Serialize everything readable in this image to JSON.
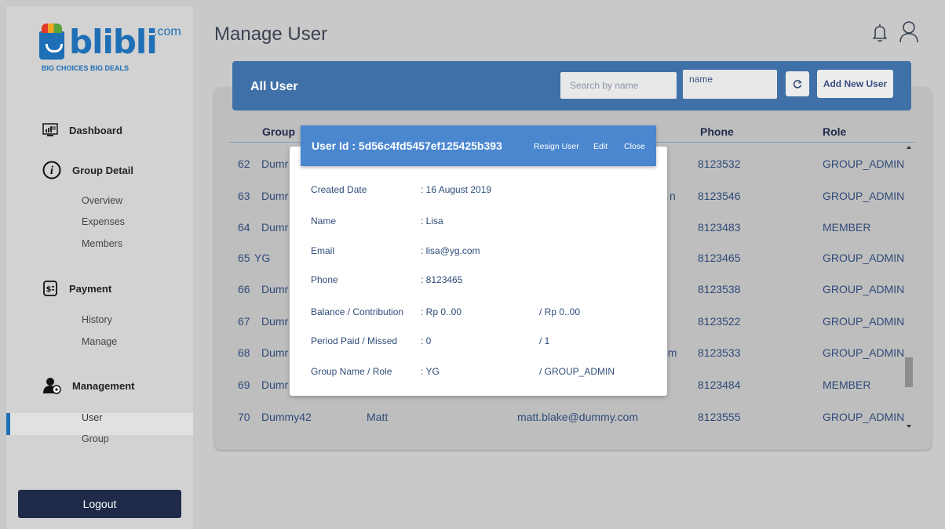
{
  "app": {
    "logo_text": "blibli",
    "logo_suffix": ".com",
    "logo_tagline": "BIG CHOICES BIG DEALS",
    "brand_color": "#1e6fb5"
  },
  "sidebar": {
    "dashboard": "Dashboard",
    "group_detail": "Group Detail",
    "group_detail_items": [
      "Overview",
      "Expenses",
      "Members"
    ],
    "payment": "Payment",
    "payment_items": [
      "History",
      "Manage"
    ],
    "management": "Management",
    "management_items": [
      "User",
      "Group"
    ],
    "active_item": "User",
    "logout": "Logout"
  },
  "header": {
    "title": "Manage User",
    "icons": [
      "bell-icon",
      "profile-icon"
    ]
  },
  "toolbar": {
    "title": "All User",
    "search_placeholder": "Search by name",
    "sort_value": "name",
    "refresh_icon": "refresh-icon",
    "add_label": "Add New User"
  },
  "table": {
    "columns": {
      "group": "Group",
      "phone": "Phone",
      "role": "Role"
    },
    "rows": [
      {
        "no": "62",
        "group": "Dumr",
        "name": "",
        "email": "",
        "phone": "8123532",
        "role": "GROUP_ADMIN"
      },
      {
        "no": "63",
        "group": "Dumr",
        "name": "",
        "email": "n",
        "phone": "8123546",
        "role": "GROUP_ADMIN"
      },
      {
        "no": "64",
        "group": "Dumr",
        "name": "",
        "email": "",
        "phone": "8123483",
        "role": "MEMBER"
      },
      {
        "no": "65",
        "group": "YG",
        "name": "",
        "email": "",
        "phone": "8123465",
        "role": "GROUP_ADMIN"
      },
      {
        "no": "66",
        "group": "Dumr",
        "name": "",
        "email": "",
        "phone": "8123538",
        "role": "GROUP_ADMIN"
      },
      {
        "no": "67",
        "group": "Dumr",
        "name": "",
        "email": "",
        "phone": "8123522",
        "role": "GROUP_ADMIN"
      },
      {
        "no": "68",
        "group": "Dumr",
        "name": "",
        "email": "com",
        "phone": "8123533",
        "role": "GROUP_ADMIN"
      },
      {
        "no": "69",
        "group": "Dumr",
        "name": "",
        "email": "",
        "phone": "8123484",
        "role": "MEMBER"
      },
      {
        "no": "70",
        "group": "Dummy42",
        "name": "Matt",
        "email": "matt.blake@dummy.com",
        "phone": "8123555",
        "role": "GROUP_ADMIN"
      }
    ]
  },
  "modal": {
    "title": "User Id : 5d56c4fd5457ef125425b393",
    "resign_label": "Resign User",
    "edit_label": "Edit",
    "close_label": "Close",
    "fields": [
      {
        "label": "Created Date",
        "value": ": 16 August 2019",
        "value2": ""
      },
      {
        "label": "Name",
        "value": ": Lisa",
        "value2": ""
      },
      {
        "label": "Email",
        "value": ": lisa@yg.com",
        "value2": ""
      },
      {
        "label": "Phone",
        "value": ": 8123465",
        "value2": ""
      },
      {
        "label": "Balance / Contribution",
        "value": ": Rp 0..00",
        "value2": "/ Rp 0..00"
      },
      {
        "label": "Period Paid / Missed",
        "value": ": 0",
        "value2": "/ 1"
      },
      {
        "label": "Group Name / Role",
        "value": ": YG",
        "value2": "/ GROUP_ADMIN"
      }
    ]
  }
}
